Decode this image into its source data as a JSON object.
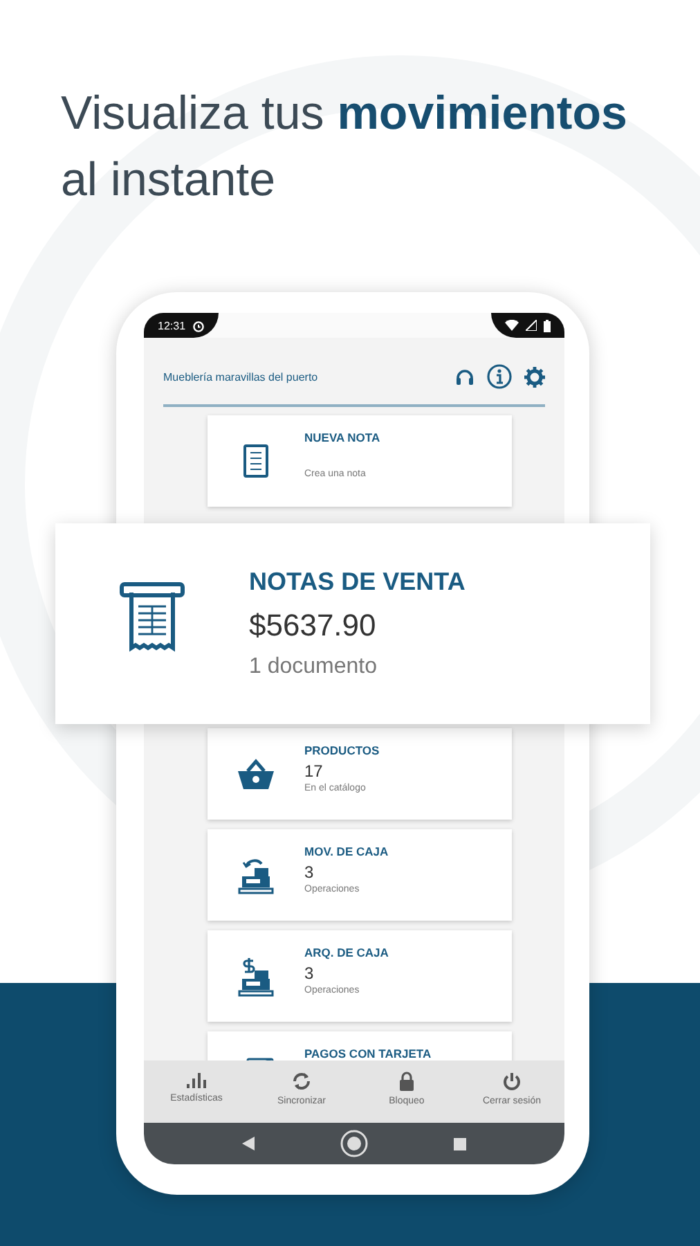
{
  "headline": {
    "text": "Visualiza tus **movimientos** al instante"
  },
  "status_bar": {
    "time": "12:31"
  },
  "app_header": {
    "title": "Mueblería maravillas del puerto"
  },
  "cards": [
    {
      "kind": "note",
      "title": "NUEVA NOTA",
      "subtitle": "Crea una nota"
    },
    {
      "kind": "products",
      "title": "PRODUCTOS",
      "value": "17",
      "subtitle": "En el catálogo"
    },
    {
      "kind": "cash_moves",
      "title": "MOV. DE CAJA",
      "value": "3",
      "subtitle": "Operaciones"
    },
    {
      "kind": "cash_count",
      "title": "ARQ. DE CAJA",
      "value": "3",
      "subtitle": "Operaciones"
    },
    {
      "kind": "card_payments",
      "title": "PAGOS CON TARJETA"
    }
  ],
  "featured_card": {
    "kind": "receipt",
    "title": "NOTAS DE VENTA",
    "value": "$5637.90",
    "subtitle": "1 documento"
  },
  "bottom_nav": [
    {
      "kind": "stats",
      "label": "Estadísticas"
    },
    {
      "kind": "sync",
      "label": "Sincronizar"
    },
    {
      "kind": "lock",
      "label": "Bloqueo"
    },
    {
      "kind": "power",
      "label": "Cerrar sesión"
    }
  ]
}
